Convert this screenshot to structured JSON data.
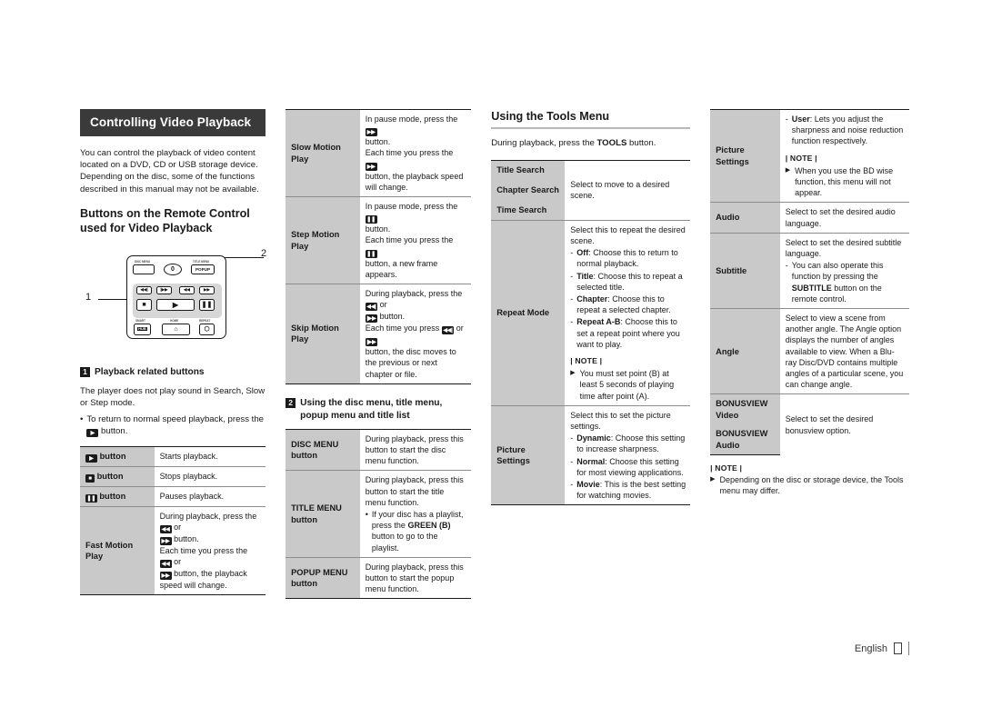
{
  "page": {
    "language_footer": "English",
    "page_number": "",
    "banner_title": "Controlling Video Playback"
  },
  "col1": {
    "intro": "You can control the playback of video content located on a DVD, CD or USB storage device. Depending on the disc, some of the functions described in this manual may not be available.",
    "heading": "Buttons on the Remote Control used for Video Playback",
    "remote": {
      "labels": {
        "disc_menu": "DISC MENU",
        "title_menu": "TITLE MENU",
        "zero": "0",
        "popup": "POPUP",
        "smart_hub_top": "SMART",
        "smart_hub": "SMART HUB",
        "home": "HOME",
        "repeat": "REPEAT"
      },
      "callout_1": "1",
      "callout_2": "2"
    },
    "subhead_num": "1",
    "subhead": "Playback related buttons",
    "note_text": "The player does not play sound in Search, Slow or Step mode.",
    "bullet": "To return to normal speed playback, press the",
    "bullet_tail": "button.",
    "table": [
      {
        "key_icon": "▶",
        "key_label": "button",
        "desc": "Starts playback."
      },
      {
        "key_icon": "■",
        "key_label": "button",
        "desc": "Stops playback."
      },
      {
        "key_icon": "❚❚",
        "key_label": "button",
        "desc": "Pauses playback."
      },
      {
        "key_label": "Fast Motion Play",
        "lines": [
          "During playback, press the",
          "or",
          "button.",
          "Each time you press the",
          "or",
          "button, the playback speed will change."
        ]
      }
    ]
  },
  "col2": {
    "table_top": [
      {
        "key_label": "Slow Motion Play",
        "lines": [
          "In pause mode, press the",
          "button.",
          "Each time you press the",
          "button, the playback speed will change."
        ]
      },
      {
        "key_label": "Step Motion Play",
        "lines": [
          "In pause mode, press the",
          "button.",
          "Each time you press the",
          "button, a new frame appears."
        ]
      },
      {
        "key_label": "Skip Motion Play",
        "lines": [
          "During playback, press the",
          "or",
          "button.",
          "Each time you press",
          "or",
          "button, the disc moves to the previous or next chapter or file."
        ]
      }
    ],
    "subhead_num": "2",
    "subhead": "Using the disc menu, title menu, popup menu and title list",
    "table_bottom": [
      {
        "key_label": "DISC MENU button",
        "desc": "During playback, press this button to start the disc menu function."
      },
      {
        "key_label": "TITLE MENU button",
        "desc": "During playback, press this button to start the title menu function.",
        "bullet": "If your disc has a playlist, press the GREEN (B) button to go to the playlist.",
        "bullet_bold": "GREEN (B)"
      },
      {
        "key_label": "POPUP MENU button",
        "desc": "During playback, press this button to start the popup menu function."
      }
    ]
  },
  "col3": {
    "heading": "Using the Tools Menu",
    "intro_pre": "During playback, press the",
    "intro_bold": "TOOLS",
    "intro_post": "button.",
    "rows": [
      {
        "key_label": "Title Search"
      },
      {
        "key_label": "Chapter Search",
        "desc": "Select to move to a desired scene."
      },
      {
        "key_label": "Time Search"
      }
    ],
    "repeat_mode": {
      "key_label": "Repeat Mode",
      "intro": "Select this to repeat the desired scene.",
      "items": [
        {
          "term": "Off",
          "text": ": Choose this to return to normal playback."
        },
        {
          "term": "Title",
          "text": ": Choose this to repeat a selected title."
        },
        {
          "term": "Chapter",
          "text": ": Choose this to repeat a selected chapter."
        },
        {
          "term": "Repeat A-B",
          "text": ": Choose this to set a repeat point where you want to play."
        }
      ],
      "note_header": "| NOTE |",
      "note": "You must set point (B) at least 5 seconds of playing time after point (A)."
    },
    "picture_settings": {
      "key_label": "Picture Settings",
      "intro": "Select this to set the picture settings.",
      "items": [
        {
          "term": "Dynamic",
          "text": ": Choose this setting to increase sharpness."
        },
        {
          "term": "Normal",
          "text": ": Choose this setting for most viewing applications."
        },
        {
          "term": "Movie",
          "text": ": This is the best setting for watching movies."
        }
      ]
    }
  },
  "col4": {
    "picture_settings_cont": {
      "key_label": "Picture Settings",
      "items": [
        {
          "term": "User",
          "text": ": Lets you adjust the sharpness and noise reduction function respectively."
        }
      ],
      "note_header": "| NOTE |",
      "note": "When you use the BD wise function, this menu will not appear."
    },
    "audio": {
      "key_label": "Audio",
      "desc": "Select to set the desired audio language."
    },
    "subtitle": {
      "key_label": "Subtitle",
      "intro": "Select to set the desired subtitle language.",
      "item_pre": "You can also operate this function by pressing the",
      "item_bold": "SUBTITLE",
      "item_post": "button on the remote control."
    },
    "angle": {
      "key_label": "Angle",
      "desc": "Select to view a scene from another angle. The Angle option displays the number of angles available to view. When a Blu-ray Disc/DVD contains multiple angles of a particular scene, you can change angle."
    },
    "bonusview": {
      "video_label": "BONUSVIEW Video",
      "audio_label": "BONUSVIEW Audio",
      "desc": "Select to set the desired bonusview option."
    },
    "note_header": "| NOTE |",
    "note": "Depending on the disc or storage device, the Tools menu may differ."
  },
  "colors": {
    "banner_bg": "#3a3a3a",
    "cell_header_bg": "#c9c9c9",
    "border_dark": "#1a1a1a",
    "border_light": "#8d8d8d"
  }
}
